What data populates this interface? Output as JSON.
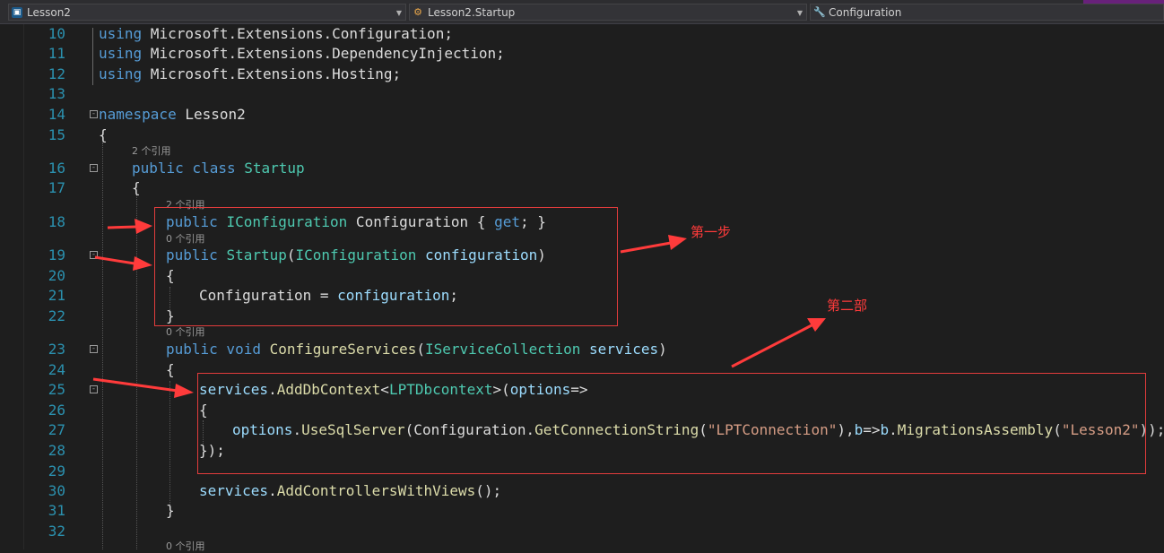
{
  "nav": {
    "project": {
      "label": "Lesson2",
      "icon": "project-icon"
    },
    "class": {
      "label": "Lesson2.Startup",
      "icon": "class-icon"
    },
    "member": {
      "label": "Configuration",
      "icon": "wrench-icon"
    }
  },
  "lines": [
    {
      "num": "10",
      "html": "<span class=\"kw\">using</span> Microsoft.Extensions.Configuration;"
    },
    {
      "num": "11",
      "html": "<span class=\"kw\">using</span> Microsoft.Extensions.DependencyInjection;"
    },
    {
      "num": "12",
      "html": "<span class=\"kw\">using</span> Microsoft.Extensions.Hosting;"
    },
    {
      "num": "13",
      "html": ""
    },
    {
      "num": "14",
      "html": "<span class=\"kw\">namespace</span> Lesson2"
    },
    {
      "num": "15",
      "html": "{"
    },
    {
      "num": "16",
      "html": "<span class=\"kw\">public class</span> <span class=\"ty\">Startup</span>"
    },
    {
      "num": "17",
      "html": "{"
    },
    {
      "num": "18",
      "html": "<span class=\"kw\">public</span> <span class=\"ty\">IConfiguration</span> Configuration { <span class=\"kw\">get</span>; }"
    },
    {
      "num": "19",
      "html": "<span class=\"kw\">public</span> <span class=\"ty\">Startup</span>(<span class=\"ty\">IConfiguration</span> <span class=\"pr\">configuration</span>)"
    },
    {
      "num": "20",
      "html": "{"
    },
    {
      "num": "21",
      "html": "Configuration = <span class=\"pr\">configuration</span>;"
    },
    {
      "num": "22",
      "html": "}"
    },
    {
      "num": "23",
      "html": "<span class=\"kw\">public void</span> <span class=\"fn\">ConfigureServices</span>(<span class=\"ty\">IServiceCollection</span> <span class=\"pr\">services</span>)"
    },
    {
      "num": "24",
      "html": "{"
    },
    {
      "num": "25",
      "html": "<span class=\"pr\">services</span>.<span class=\"fn\">AddDbContext</span>&lt;<span class=\"ty\">LPTDbcontext</span>&gt;(<span class=\"pr\">options</span>=&gt;"
    },
    {
      "num": "26",
      "html": "{"
    },
    {
      "num": "27",
      "html": "<span class=\"pr\">options</span>.<span class=\"fn\">UseSqlServer</span>(Configuration.<span class=\"fn\">GetConnectionString</span>(<span class=\"str\">\"LPTConnection\"</span>),<span class=\"pr\">b</span>=&gt;<span class=\"pr\">b</span>.<span class=\"fn\">MigrationsAssembly</span>(<span class=\"str\">\"Lesson2\"</span>));"
    },
    {
      "num": "28",
      "html": "});"
    },
    {
      "num": "29",
      "html": ""
    },
    {
      "num": "30",
      "html": "<span class=\"pr\">services</span>.<span class=\"fn\">AddControllersWithViews</span>();"
    },
    {
      "num": "31",
      "html": "}"
    },
    {
      "num": "32",
      "html": ""
    }
  ],
  "codelens": [
    {
      "text": "2 个引用"
    },
    {
      "text": "2 个引用"
    },
    {
      "text": "0 个引用"
    },
    {
      "text": "0 个引用"
    },
    {
      "text": "0 个引用"
    }
  ],
  "annotations": {
    "step1": "第一步",
    "step2": "第二部"
  },
  "colors": {
    "annotation": "#ff3b3b",
    "keyword": "#569cd6",
    "type": "#4ec9b0",
    "method": "#dcdcaa",
    "param": "#9cdcfe",
    "string": "#d69d85",
    "line_number": "#2b91af"
  }
}
